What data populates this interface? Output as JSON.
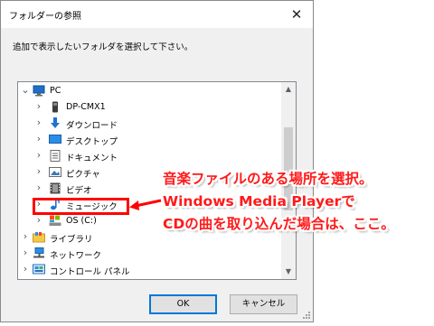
{
  "dialog": {
    "title": "フォルダーの参照",
    "close_glyph": "✕",
    "instruction": "追加で表示したいフォルダを選択して下さい。",
    "ok_label": "OK",
    "cancel_label": "キャンセル"
  },
  "tree": {
    "items": [
      {
        "label": "PC",
        "icon": "pc-icon",
        "expanded": true
      },
      {
        "label": "DP-CMX1",
        "icon": "device-icon"
      },
      {
        "label": "ダウンロード",
        "icon": "download-icon"
      },
      {
        "label": "デスクトップ",
        "icon": "desktop-icon"
      },
      {
        "label": "ドキュメント",
        "icon": "documents-icon"
      },
      {
        "label": "ピクチャ",
        "icon": "pictures-icon"
      },
      {
        "label": "ビデオ",
        "icon": "videos-icon"
      },
      {
        "label": "ミュージック",
        "icon": "music-icon",
        "annotated": true
      },
      {
        "label": "OS (C:)",
        "icon": "drive-icon"
      },
      {
        "label": "ライブラリ",
        "icon": "library-icon"
      },
      {
        "label": "ネットワーク",
        "icon": "network-icon"
      },
      {
        "label": "コントロール パネル",
        "icon": "control-panel-icon"
      }
    ]
  },
  "annotation": {
    "line1": "音楽ファイルのある場所を選択。",
    "line2": "Windows Media Playerで",
    "line3": "CDの曲を取り込んだ場合は、ここ。",
    "color": "#ff1a1a"
  }
}
